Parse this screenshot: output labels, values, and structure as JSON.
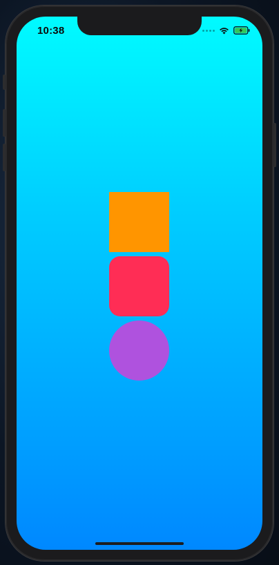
{
  "status_bar": {
    "time": "10:38",
    "signal_icon": "cellular-dots-icon",
    "wifi_icon": "wifi-icon",
    "battery_icon": "battery-charging-icon"
  },
  "colors": {
    "background_top": "#00fbff",
    "background_bottom": "#0088ff",
    "square": "#ff9500",
    "rounded_square": "#ff2d55",
    "circle": "#af52de",
    "battery": "#34c759"
  },
  "shapes": [
    {
      "kind": "square",
      "color": "#ff9500"
    },
    {
      "kind": "rounded-square",
      "color": "#ff2d55"
    },
    {
      "kind": "circle",
      "color": "#af52de"
    }
  ]
}
